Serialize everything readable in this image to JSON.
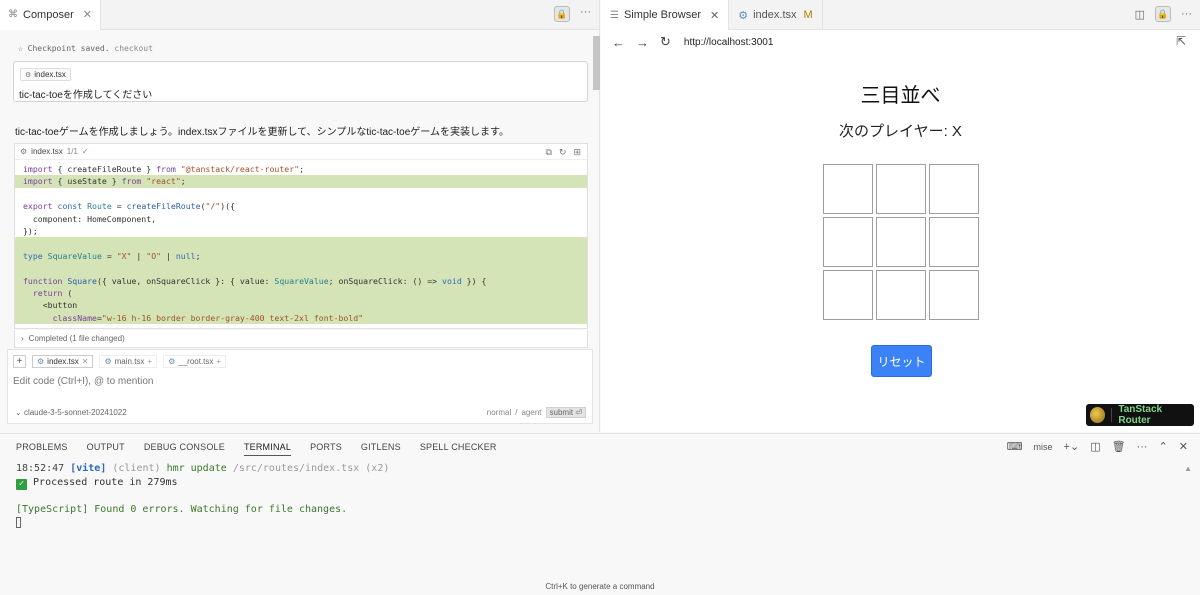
{
  "composer": {
    "tab_label": "Composer",
    "checkpoint_text": "Checkpoint saved.",
    "checkpoint_link": "checkout",
    "message_chip": "index.tsx",
    "message_text": "tic-tac-toeを作成してください",
    "reply_text": "tic-tac-toeゲームを作成しましょう。index.tsxファイルを更新して、シンプルなtic-tac-toeゲームを実装します。",
    "code_file": "index.tsx",
    "code_count": "1/1",
    "completed_text": "Completed (1 file changed)",
    "input_chips": [
      "index.tsx",
      "main.tsx",
      "__root.tsx"
    ],
    "input_placeholder": "Edit code (Ctrl+I), @ to mention",
    "model": "claude-3-5-sonnet-20241022",
    "mode_normal": "normal",
    "mode_agent": "agent",
    "submit_label": "submit"
  },
  "browser": {
    "tabs": [
      {
        "label": "Simple Browser"
      },
      {
        "label": "index.tsx",
        "badge": "M"
      }
    ],
    "url": "http://localhost:3001",
    "page_title": "三目並べ",
    "next_player": "次のプレイヤー: X",
    "board": [
      "",
      "",
      "",
      "",
      "",
      "",
      "",
      "",
      ""
    ],
    "reset_label": "リセット",
    "devtools_label": "TanStack Router"
  },
  "panel": {
    "tabs": [
      "PROBLEMS",
      "OUTPUT",
      "DEBUG CONSOLE",
      "TERMINAL",
      "PORTS",
      "GITLENS",
      "SPELL CHECKER"
    ],
    "active_tab": "TERMINAL",
    "shell_label": "mise",
    "terminal": {
      "time": "18:52:47",
      "vite": "[vite]",
      "client": "(client)",
      "hmr": "hmr update",
      "path": "/src/routes/index.tsx",
      "count": "(x2)",
      "processed": "Processed route in 279ms",
      "ts_line": "[TypeScript] Found 0 errors. Watching for file changes."
    },
    "hint": "Ctrl+K to generate a command"
  },
  "colors": {
    "reset_button": "#3b82f6",
    "added_line_bg": "#d4e4b6",
    "devtools_bg": "#111111"
  }
}
